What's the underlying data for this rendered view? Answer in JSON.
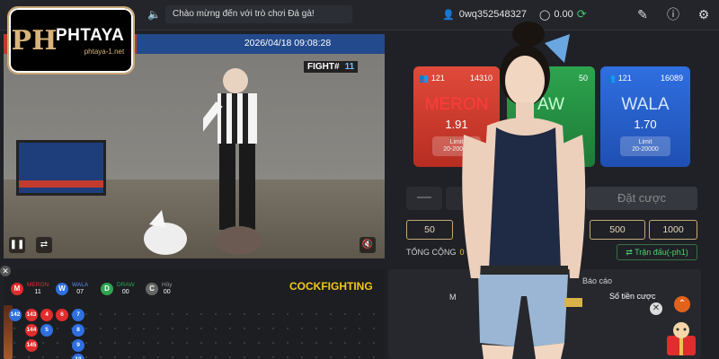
{
  "brand": {
    "name": "PHTAYA",
    "domain": "phtaya-1.net",
    "mark": "PH"
  },
  "topbar": {
    "marquee": "Chào mừng đến với trò chơi Đá gà!",
    "username": "0wq352548327",
    "balance": "0.00"
  },
  "video": {
    "datetime": "2026/04/18 09:08:28",
    "fight_label": "FIGHT#",
    "fight_number": "11"
  },
  "bets": {
    "meron": {
      "label": "MERON",
      "count": "121",
      "pool": "14310",
      "odds": "1.91",
      "limit_label": "Limit",
      "limit": "20-20000",
      "color": "#e04a3a"
    },
    "draw": {
      "label": "AW",
      "count_suffix": "50",
      "color": "#2da44e"
    },
    "wala": {
      "label": "WALA",
      "count": "121",
      "pool": "16089",
      "odds": "1.70",
      "limit_label": "Limit",
      "limit": "20-20000",
      "color": "#2f6fe0"
    }
  },
  "stake": {
    "minus": "—",
    "value": "50",
    "place_label": "Đặt cược"
  },
  "chips": [
    "50",
    "500",
    "1000"
  ],
  "total": {
    "label": "TỔNG CỘNG",
    "value": "0"
  },
  "fight_selector": "Trận đấu(-ph1)",
  "report": {
    "title": "Báo cáo",
    "amount_label": "Số tiền cược",
    "m_label": "M"
  },
  "scoreboard": {
    "title": "COCKFIGHTING",
    "stats": [
      {
        "icon": "M",
        "label": "MERON",
        "value": "11",
        "color": "#e02d2d",
        "label_color": "#e02d2d"
      },
      {
        "icon": "W",
        "label": "WALA",
        "value": "07",
        "color": "#2f6fe0",
        "label_color": "#5b8df0"
      },
      {
        "icon": "D",
        "label": "DRAW",
        "value": "00",
        "color": "#2da44e",
        "label_color": "#2da44e"
      },
      {
        "icon": "C",
        "label": "Hủy",
        "value": "00",
        "color": "#666666",
        "label_color": "#999999"
      }
    ],
    "balls": [
      "142",
      "143",
      "4",
      "6",
      "7",
      "144",
      "5",
      "8",
      "145",
      "9",
      "10"
    ]
  },
  "colors": {
    "accent_gold": "#c9a978",
    "title_yellow": "#f2c81a",
    "green": "#3fc26b"
  }
}
